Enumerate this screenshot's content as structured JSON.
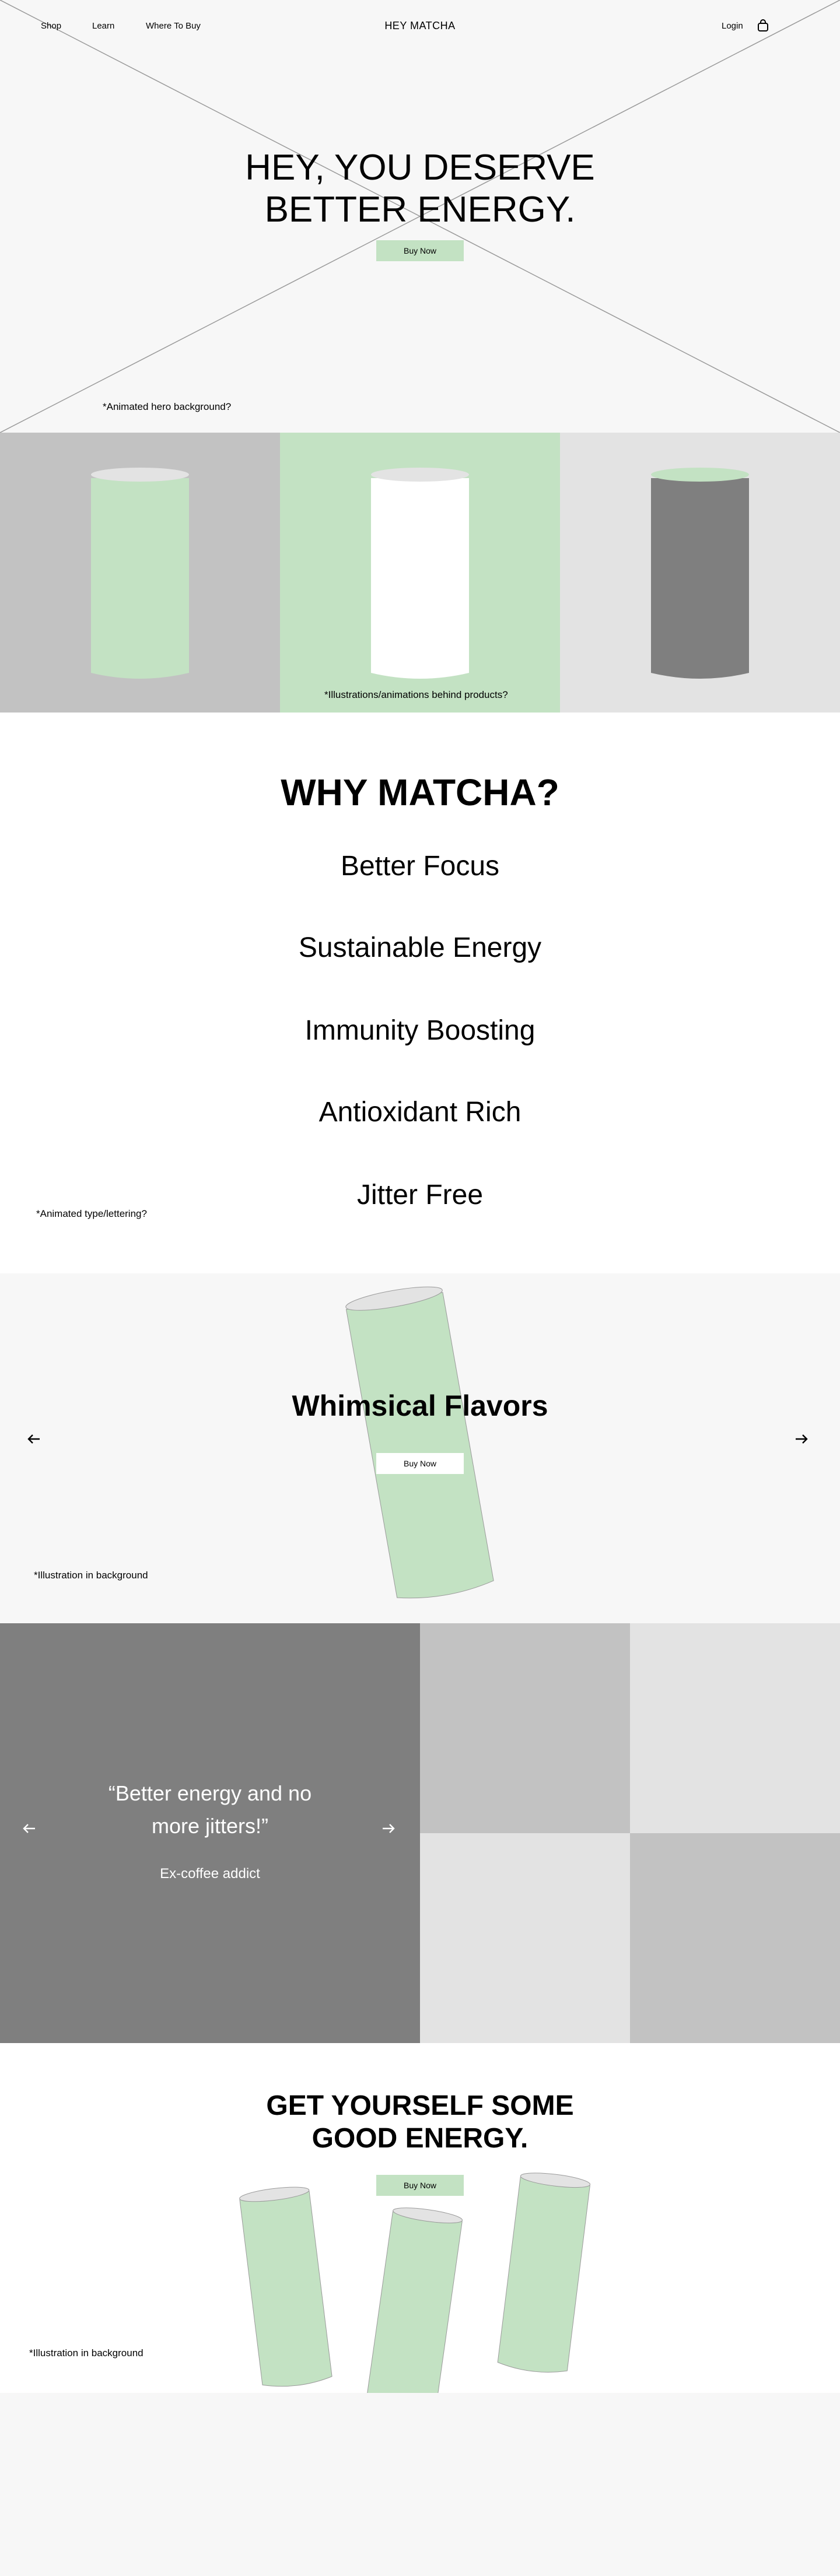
{
  "nav": {
    "links": [
      "Shop",
      "Learn",
      "Where To Buy"
    ],
    "brand": "HEY MATCHA",
    "login": "Login",
    "cart_icon": "shopping-bag-icon"
  },
  "hero": {
    "title_line1": "HEY, YOU DESERVE",
    "title_line2": "BETTER ENERGY.",
    "cta": "Buy Now",
    "note": "*Animated hero background?"
  },
  "products": {
    "note": "*Illustrations/animations behind products?",
    "panels": [
      {
        "bg": "#c2c2c2",
        "body": "#c3e2c3",
        "lid": "#e3e3e3"
      },
      {
        "bg": "#c3e2c3",
        "body": "#ffffff",
        "lid": "#e3e3e3"
      },
      {
        "bg": "#e3e3e3",
        "body": "#7f7f7f",
        "lid": "#c3e2c3"
      }
    ]
  },
  "why": {
    "title": "WHY MATCHA?",
    "items": [
      "Better Focus",
      "Sustainable Energy",
      "Immunity Boosting",
      "Antioxidant Rich",
      "Jitter Free"
    ],
    "note": "*Animated type/lettering?"
  },
  "flavors": {
    "title": "Whimsical Flavors",
    "cta": "Buy Now",
    "note": "*Illustration in background",
    "prev_icon": "arrow-left-icon",
    "next_icon": "arrow-right-icon"
  },
  "testimonial": {
    "quote_line1": "“Better energy and no",
    "quote_line2": "more jitters!”",
    "author": "Ex-coffee addict",
    "prev_icon": "arrow-left-icon",
    "next_icon": "arrow-right-icon",
    "tiles": [
      "#c2c2c2",
      "#e3e3e3",
      "#e3e3e3",
      "#c2c2c2"
    ]
  },
  "cta": {
    "title_line1": "GET YOURSELF SOME",
    "title_line2": "GOOD ENERGY.",
    "button": "Buy Now",
    "note": "*Illustration in background"
  },
  "colors": {
    "accent_green": "#c3e2c3",
    "light_gray": "#e3e3e3",
    "mid_gray": "#c2c2c2",
    "dark_gray": "#7f7f7f",
    "page_bg": "#f7f7f7"
  }
}
